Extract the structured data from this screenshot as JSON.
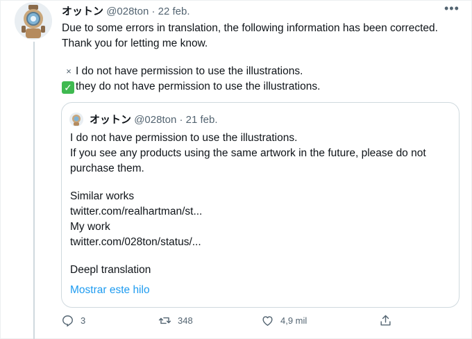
{
  "tweet": {
    "author_name": "オットン",
    "author_handle": "@028ton",
    "separator": "·",
    "date": "22 feb.",
    "more_label": "•••",
    "text_line1": "Due to some errors in translation, the following information has been corrected. Thank you for letting me know.",
    "cross_mark": "×",
    "wrong_line": "I do not have permission to use the illustrations.",
    "check_mark": "✓",
    "correct_line": "they do not have permission to use the illustrations."
  },
  "quote": {
    "author_name": "オットン",
    "author_handle": "@028ton",
    "separator": "·",
    "date": "21 feb.",
    "line1": "I do not have permission to use the illustrations.",
    "line2": "If you see any products using the same artwork in the future, please do not purchase them.",
    "line3": "Similar works",
    "line4": "twitter.com/realhartman/st...",
    "line5": "My work",
    "line6": "twitter.com/028ton/status/...",
    "line7": "Deepl translation",
    "show_thread": "Mostrar este hilo"
  },
  "actions": {
    "reply_count": "3",
    "retweet_count": "348",
    "like_count": "4,9 mil"
  },
  "icons": [
    "reply-icon",
    "retweet-icon",
    "like-icon",
    "share-icon",
    "more-icon"
  ],
  "colors": {
    "link": "#1d9bf0",
    "muted": "#536471",
    "check": "#3fb950",
    "border": "#cfd9de"
  }
}
